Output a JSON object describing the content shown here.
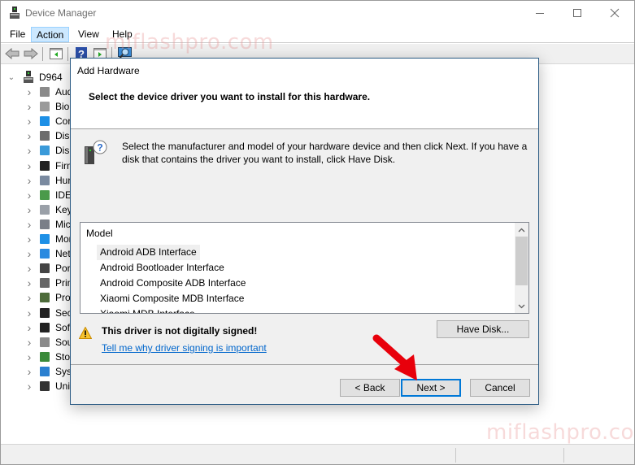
{
  "window": {
    "title": "Device Manager",
    "controls": {
      "minimize": "minimize",
      "maximize": "maximize",
      "close": "close"
    }
  },
  "menubar": {
    "items": [
      {
        "label": "File",
        "active": false
      },
      {
        "label": "Action",
        "active": true
      },
      {
        "label": "View",
        "active": false
      },
      {
        "label": "Help",
        "active": false
      }
    ]
  },
  "toolbar": {
    "buttons": [
      "back-arrow-icon",
      "forward-arrow-icon",
      "show-hide-console-tree-icon",
      "help-icon",
      "properties-pane-icon",
      "scan-hardware-icon"
    ]
  },
  "tree": {
    "root": "D964",
    "items": [
      {
        "label": "Audio inputs and outputs",
        "visible": "Aud",
        "icon": "speaker-icon"
      },
      {
        "label": "Biometric devices",
        "visible": "Bior",
        "icon": "fingerprint-icon"
      },
      {
        "label": "Computer",
        "visible": "Cor",
        "icon": "monitor-icon"
      },
      {
        "label": "Disk drives",
        "visible": "Disk",
        "icon": "disk-drive-icon"
      },
      {
        "label": "Display adapters",
        "visible": "Disp",
        "icon": "display-adapter-icon"
      },
      {
        "label": "Firmware",
        "visible": "Firm",
        "icon": "chip-icon"
      },
      {
        "label": "Human Interface Devices",
        "visible": "Hur",
        "icon": "hid-icon"
      },
      {
        "label": "IDE ATA/ATAPI controllers",
        "visible": "IDE",
        "icon": "ide-controller-icon"
      },
      {
        "label": "Keyboards",
        "visible": "Key",
        "icon": "keyboard-icon"
      },
      {
        "label": "Mice and other pointing devices",
        "visible": "Mic",
        "icon": "mouse-icon"
      },
      {
        "label": "Monitors",
        "visible": "Mor",
        "icon": "monitor-icon"
      },
      {
        "label": "Network adapters",
        "visible": "Net",
        "icon": "network-icon"
      },
      {
        "label": "Ports (COM & LPT)",
        "visible": "Port",
        "icon": "port-icon"
      },
      {
        "label": "Print queues",
        "visible": "Prin",
        "icon": "printer-icon"
      },
      {
        "label": "Processors",
        "visible": "Proc",
        "icon": "processor-icon"
      },
      {
        "label": "Security devices",
        "visible": "Secu",
        "icon": "security-key-icon"
      },
      {
        "label": "Software devices",
        "visible": "Soft",
        "icon": "software-device-icon"
      },
      {
        "label": "Sound, video and game controllers",
        "visible": "Sou",
        "icon": "speaker-icon"
      },
      {
        "label": "Storage controllers",
        "visible": "Stor",
        "icon": "storage-controller-icon"
      },
      {
        "label": "System devices",
        "visible": "Syst",
        "icon": "system-device-icon"
      },
      {
        "label": "Universal Serial Bus controllers",
        "visible": "Univ",
        "icon": "usb-icon"
      }
    ]
  },
  "watermark": "miflashpro.com",
  "dialog": {
    "title": "Add Hardware",
    "heading": "Select the device driver you want to install for this hardware.",
    "info": "Select the manufacturer and model of your hardware device and then click Next. If you have a disk that contains the driver you want to install, click Have Disk.",
    "list": {
      "header": "Model",
      "items": [
        {
          "label": "Android ADB Interface",
          "selected": true
        },
        {
          "label": "Android Bootloader Interface",
          "selected": false
        },
        {
          "label": "Android Composite ADB Interface",
          "selected": false
        },
        {
          "label": "Xiaomi Composite MDB Interface",
          "selected": false
        },
        {
          "label": "Xiaomi MDB Interface",
          "selected": false
        }
      ]
    },
    "warning": "This driver is not digitally signed!",
    "link": "Tell me why driver signing is important",
    "buttons": {
      "have_disk": "Have Disk...",
      "back": "< Back",
      "next": "Next >",
      "cancel": "Cancel"
    }
  },
  "colors": {
    "accent": "#0078d7",
    "link": "#0066cc",
    "annotation_arrow": "#e8000b",
    "menu_active": "#cce8ff"
  }
}
